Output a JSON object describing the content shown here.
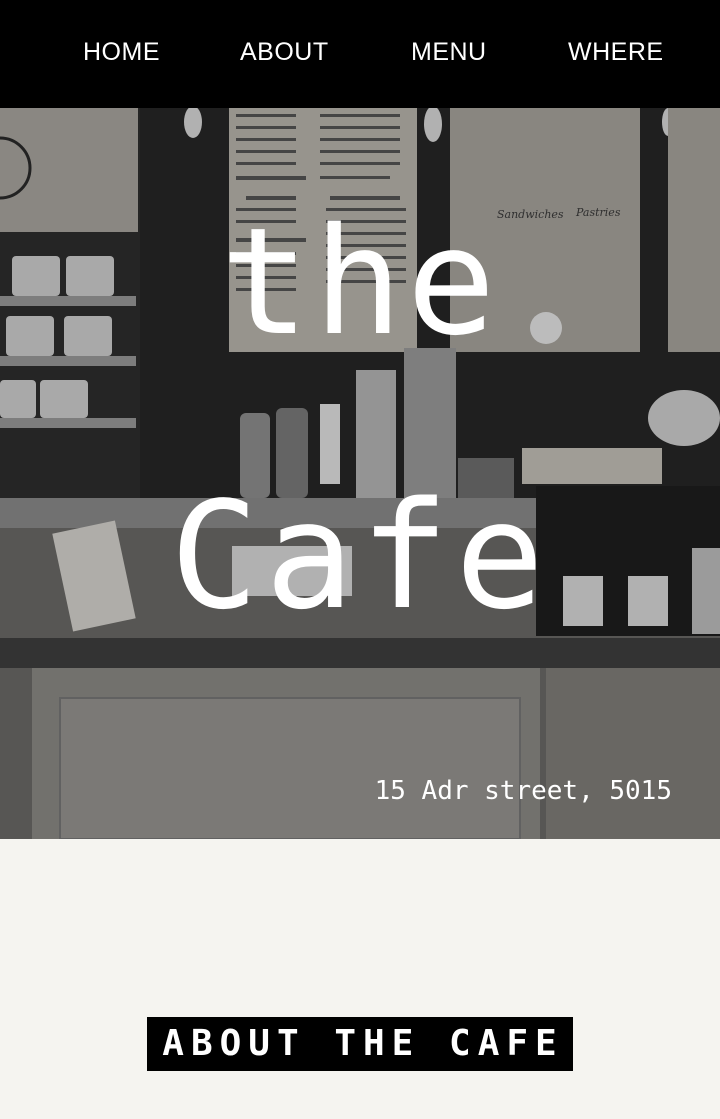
{
  "nav": {
    "items": [
      {
        "label": "HOME"
      },
      {
        "label": "ABOUT"
      },
      {
        "label": "MENU"
      },
      {
        "label": "WHERE"
      }
    ]
  },
  "hero": {
    "title_line1": "the",
    "title_line2": "Cafe",
    "address": "15 Adr street, 5015",
    "menu_board_labels": [
      "Sandwiches",
      "Pastries"
    ]
  },
  "about": {
    "heading": "ABOUT THE CAFE"
  },
  "colors": {
    "nav_bg": "#000000",
    "section_bg": "#f5f4f0",
    "text_light": "#ffffff"
  }
}
